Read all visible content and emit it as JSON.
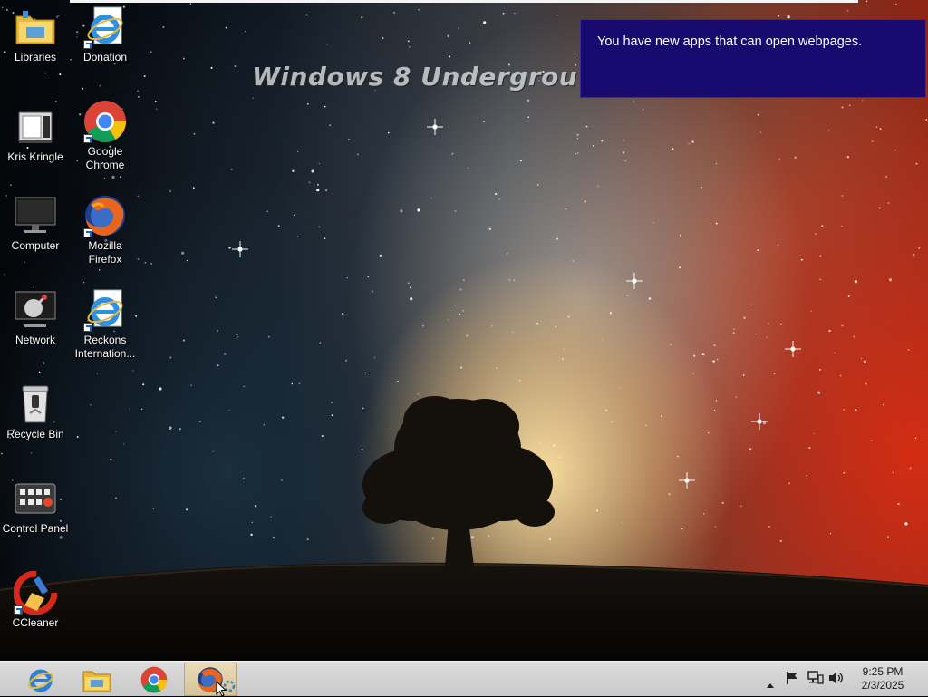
{
  "wallpaper": {
    "watermark": "Windows 8 Undergrou"
  },
  "notification": {
    "message": "You have new apps that can open webpages.",
    "background": "#180a6e"
  },
  "desktop_icons": [
    {
      "label": "Libraries",
      "icon": "libraries-folder-icon"
    },
    {
      "label": "Donation",
      "icon": "internet-explorer-icon"
    },
    {
      "label": "Kris Kringle",
      "icon": "kris-kringle-printer-icon"
    },
    {
      "label": "Google Chrome",
      "icon": "google-chrome-icon"
    },
    {
      "label": "Computer",
      "icon": "computer-monitor-icon"
    },
    {
      "label": "Mozilla Firefox",
      "icon": "firefox-icon"
    },
    {
      "label": "Network",
      "icon": "network-satellite-icon"
    },
    {
      "label": "Reckons Internation...",
      "icon": "internet-explorer-icon"
    },
    {
      "label": "Recycle Bin",
      "icon": "recycle-bin-icon"
    },
    {
      "label": "Control Panel",
      "icon": "control-panel-icon"
    },
    {
      "label": "CCleaner",
      "icon": "ccleaner-icon"
    }
  ],
  "taskbar": {
    "pinned": [
      {
        "name": "Internet Explorer",
        "icon": "internet-explorer-icon",
        "active": false
      },
      {
        "name": "File Explorer",
        "icon": "file-explorer-folder-icon",
        "active": false
      },
      {
        "name": "Google Chrome",
        "icon": "google-chrome-icon",
        "active": false
      },
      {
        "name": "Firefox",
        "icon": "firefox-icon",
        "active": true
      }
    ],
    "tray": {
      "icons": [
        "show-hidden-icons-arrow-icon",
        "action-center-flag-icon",
        "network-icon",
        "volume-icon"
      ],
      "time": "9:25 PM",
      "date": "2/3/2025"
    },
    "accent": "#d6c397"
  }
}
